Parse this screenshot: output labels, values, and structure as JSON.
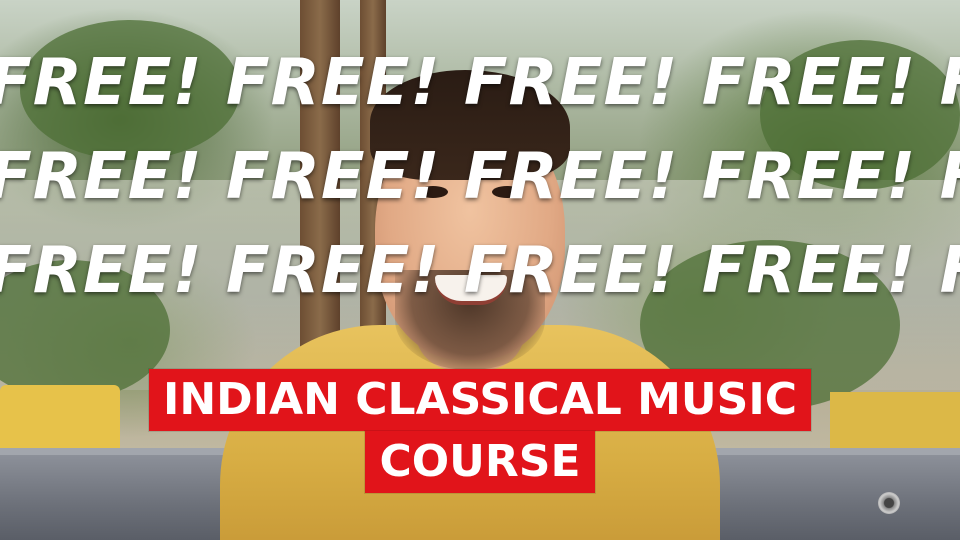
{
  "overlay": {
    "free_rows": [
      "FREE! FREE! FREE! FREE! FREE!",
      "FREE! FREE! FREE! FREE! FREE!",
      "FREE! FREE! FREE! FREE! FREE!"
    ]
  },
  "caption": {
    "line1": "INDIAN CLASSICAL MUSIC",
    "line2": "COURSE"
  },
  "colors": {
    "caption_bg": "#e1141a",
    "caption_text": "#ffffff",
    "shirt": "#e0b650"
  }
}
